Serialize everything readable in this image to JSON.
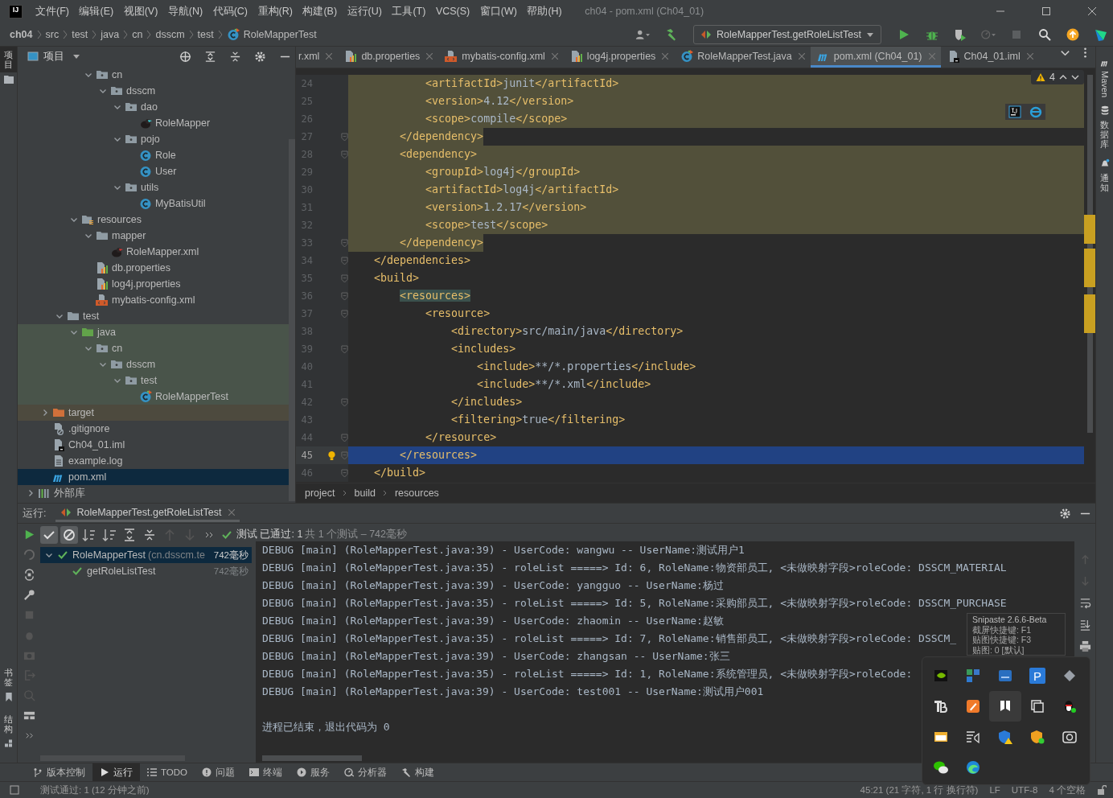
{
  "title_bar": {
    "logo": "IJ",
    "menu": [
      "文件(F)",
      "编辑(E)",
      "视图(V)",
      "导航(N)",
      "代码(C)",
      "重构(R)",
      "构建(B)",
      "运行(U)",
      "工具(T)",
      "VCS(S)",
      "窗口(W)",
      "帮助(H)"
    ],
    "title": "ch04 - pom.xml (Ch04_01)"
  },
  "nav_bar": {
    "breadcrumbs": [
      {
        "label": "ch04",
        "kind": "root"
      },
      {
        "label": "src",
        "kind": "dir"
      },
      {
        "label": "test",
        "kind": "dir"
      },
      {
        "label": "java",
        "kind": "dir"
      },
      {
        "label": "cn",
        "kind": "dir"
      },
      {
        "label": "dsscm",
        "kind": "dir"
      },
      {
        "label": "test",
        "kind": "dir"
      },
      {
        "label": "RoleMapperTest",
        "kind": "test-class"
      }
    ],
    "run_config": "RoleMapperTest.getRoleListTest"
  },
  "left_strip": {
    "top": [
      {
        "label": "项目",
        "selected": true
      }
    ],
    "bottom": [
      {
        "label": "书签",
        "kind": "bookmark"
      },
      {
        "label": "结构",
        "kind": "structure"
      }
    ]
  },
  "project_panel": {
    "title": "项目",
    "tree": [
      {
        "children": [
          {
            "children": [
              {
                "children": [
                  {
                    "children": [
                      {
                        "name": "cn",
                        "kind": "package",
                        "expanded": true,
                        "selected": false,
                        "children": [
                          {
                            "name": "dsscm",
                            "kind": "package",
                            "expanded": true,
                            "selected": false,
                            "children": [
                              {
                                "name": "dao",
                                "kind": "package",
                                "expanded": true,
                                "selected": false,
                                "children": [
                                  {
                                    "name": "RoleMapper",
                                    "kind": "mapper",
                                    "selected": false
                                  }
                                ]
                              },
                              {
                                "name": "pojo",
                                "kind": "package",
                                "expanded": true,
                                "selected": false,
                                "children": [
                                  {
                                    "name": "Role",
                                    "kind": "class",
                                    "selected": false
                                  },
                                  {
                                    "name": "User",
                                    "kind": "class",
                                    "selected": false
                                  }
                                ]
                              },
                              {
                                "name": "utils",
                                "kind": "package",
                                "expanded": true,
                                "selected": false,
                                "children": [
                                  {
                                    "name": "MyBatisUtil",
                                    "kind": "class",
                                    "selected": false
                                  }
                                ]
                              }
                            ]
                          }
                        ]
                      }
                    ]
                  },
                  {
                    "name": "resources",
                    "kind": "resources",
                    "expanded": true,
                    "selected": false,
                    "children": [
                      {
                        "name": "mapper",
                        "kind": "folder",
                        "expanded": true,
                        "selected": false,
                        "children": [
                          {
                            "name": "RoleMapper.xml",
                            "kind": "mapper-xml",
                            "selected": false
                          }
                        ]
                      },
                      {
                        "name": "db.properties",
                        "kind": "properties",
                        "selected": false
                      },
                      {
                        "name": "log4j.properties",
                        "kind": "properties",
                        "selected": false
                      },
                      {
                        "name": "mybatis-config.xml",
                        "kind": "xml-config",
                        "selected": false
                      }
                    ]
                  }
                ]
              },
              {
                "name": "test",
                "kind": "folder",
                "expanded": true,
                "selected": false,
                "children": [
                  {
                    "name": "java",
                    "kind": "test-root",
                    "expanded": true,
                    "selected": false,
                    "children": [
                      {
                        "name": "cn",
                        "kind": "package",
                        "expanded": true,
                        "selected": false,
                        "children": [
                          {
                            "name": "dsscm",
                            "kind": "package",
                            "expanded": true,
                            "selected": false,
                            "children": [
                              {
                                "name": "test",
                                "kind": "package",
                                "expanded": true,
                                "selected": false,
                                "children": [
                                  {
                                    "name": "RoleMapperTest",
                                    "kind": "test-class",
                                    "selected": false
                                  }
                                ]
                              }
                            ]
                          }
                        ]
                      }
                    ]
                  }
                ]
              }
            ]
          },
          {
            "name": "target",
            "kind": "excluded",
            "expanded": false,
            "selected": false
          },
          {
            "name": ".gitignore",
            "kind": "gitignore",
            "selected": false
          },
          {
            "name": "Ch04_01.iml",
            "kind": "iml",
            "selected": false
          },
          {
            "name": "example.log",
            "kind": "log",
            "selected": false
          },
          {
            "name": "pom.xml",
            "kind": "maven",
            "selected": true
          }
        ]
      },
      {
        "name": "外部库",
        "kind": "library",
        "expanded": false,
        "selected": false
      }
    ]
  },
  "editor": {
    "tabs": [
      {
        "label": "r.xml",
        "selected": false
      },
      {
        "label": "db.properties",
        "kind": "properties",
        "selected": false
      },
      {
        "label": "mybatis-config.xml",
        "kind": "xml-config",
        "selected": false
      },
      {
        "label": "log4j.properties",
        "kind": "properties",
        "selected": false
      },
      {
        "label": "RoleMapperTest.java",
        "kind": "test-class",
        "selected": false
      },
      {
        "label": "pom.xml (Ch04_01)",
        "kind": "maven",
        "selected": true
      },
      {
        "label": "Ch04_01.iml",
        "kind": "iml",
        "selected": false
      }
    ],
    "warnings": "4",
    "lines": [
      {
        "number": "24",
        "text": "            <artifactId>junit</artifactId>",
        "kind": "block",
        "fold": false,
        "current": false
      },
      {
        "number": "25",
        "text": "            <version>4.12</version>",
        "kind": "block",
        "fold": false,
        "current": false
      },
      {
        "number": "26",
        "text": "            <scope>compile</scope>",
        "kind": "block",
        "fold": false,
        "current": false
      },
      {
        "number": "27",
        "text": "        </dependency>",
        "kind": "partial",
        "fold": true,
        "current": false
      },
      {
        "number": "28",
        "text": "        <dependency>",
        "kind": "block",
        "fold": true,
        "current": false
      },
      {
        "number": "29",
        "text": "            <groupId>log4j</groupId>",
        "kind": "block",
        "fold": false,
        "current": false
      },
      {
        "number": "30",
        "text": "            <artifactId>log4j</artifactId>",
        "kind": "block",
        "fold": false,
        "current": false
      },
      {
        "number": "31",
        "text": "            <version>1.2.17</version>",
        "kind": "block",
        "fold": false,
        "current": false
      },
      {
        "number": "32",
        "text": "            <scope>test</scope>",
        "kind": "block",
        "fold": false,
        "current": false
      },
      {
        "number": "33",
        "text": "        </dependency>",
        "kind": "partial",
        "fold": true,
        "current": false
      },
      {
        "number": "34",
        "text": "    </dependencies>",
        "kind": "plain",
        "fold": true,
        "current": false
      },
      {
        "number": "35",
        "text": "    <build>",
        "kind": "plain",
        "fold": true,
        "current": false
      },
      {
        "number": "36",
        "text": "        <resources>",
        "kind": "match",
        "fold": true,
        "current": false
      },
      {
        "number": "37",
        "text": "            <resource>",
        "kind": "plain",
        "fold": true,
        "current": false
      },
      {
        "number": "38",
        "text": "                <directory>src/main/java</directory>",
        "kind": "plain",
        "fold": false,
        "current": false
      },
      {
        "number": "39",
        "text": "                <includes>",
        "kind": "plain",
        "fold": true,
        "current": false
      },
      {
        "number": "40",
        "text": "                    <include>**/*.properties</include>",
        "kind": "plain",
        "fold": false,
        "current": false
      },
      {
        "number": "41",
        "text": "                    <include>**/*.xml</include>",
        "kind": "plain",
        "fold": false,
        "current": false
      },
      {
        "number": "42",
        "text": "                </includes>",
        "kind": "plain",
        "fold": true,
        "current": false
      },
      {
        "number": "43",
        "text": "                <filtering>true</filtering>",
        "kind": "plain",
        "fold": false,
        "current": false
      },
      {
        "number": "44",
        "text": "            </resource>",
        "kind": "plain",
        "fold": true,
        "current": false
      },
      {
        "number": "45",
        "text": "        </resources>",
        "kind": "plain",
        "fold": true,
        "current": true
      },
      {
        "number": "46",
        "text": "    </build>",
        "kind": "plain",
        "fold": true,
        "current": false
      }
    ],
    "breadcrumbs": [
      "project",
      "build",
      "resources"
    ]
  },
  "right_strip": [
    {
      "label": "Maven",
      "kind": "maven"
    },
    {
      "label": "数据库",
      "kind": "database"
    },
    {
      "label": "通知",
      "kind": "bell"
    }
  ],
  "run_panel": {
    "label": "运行:",
    "tab": "RoleMapperTest.getRoleListTest",
    "status": "测试 已通过: 1",
    "status_detail": "共 1 个测试 – 742毫秒",
    "tests": [
      {
        "name": "RoleMapperTest",
        "detail": "(cn.dsscm.te",
        "time": "742毫秒",
        "expanded": true,
        "selected": true,
        "children": [
          {
            "name": "getRoleListTest",
            "time": "742毫秒",
            "selected": false
          }
        ]
      }
    ],
    "console": [
      "DEBUG [main] (RoleMapperTest.java:39) - UserCode: wangwu -- UserName:测试用户1",
      "DEBUG [main] (RoleMapperTest.java:35) - roleList =====> Id: 6, RoleName:物资部员工, <未做映射字段>roleCode: DSSCM_MATERIAL",
      "DEBUG [main] (RoleMapperTest.java:39) - UserCode: yangguo -- UserName:杨过",
      "DEBUG [main] (RoleMapperTest.java:35) - roleList =====> Id: 5, RoleName:采购部员工, <未做映射字段>roleCode: DSSCM_PURCHASE",
      "DEBUG [main] (RoleMapperTest.java:39) - UserCode: zhaomin -- UserName:赵敏",
      "DEBUG [main] (RoleMapperTest.java:35) - roleList =====> Id: 7, RoleName:销售部员工, <未做映射字段>roleCode: DSSCM_",
      "DEBUG [main] (RoleMapperTest.java:39) - UserCode: zhangsan -- UserName:张三",
      "DEBUG [main] (RoleMapperTest.java:35) - roleList =====> Id: 1, RoleName:系统管理员, <未做映射字段>roleCode:",
      "DEBUG [main] (RoleMapperTest.java:39) - UserCode: test001 -- UserName:测试用户001"
    ],
    "exit": "进程已结束，退出代码为 0"
  },
  "tool_tabs": [
    {
      "label": "版本控制",
      "kind": "vcs",
      "selected": false
    },
    {
      "label": "运行",
      "kind": "run",
      "selected": true
    },
    {
      "label": "TODO",
      "kind": "todo",
      "selected": false
    },
    {
      "label": "问题",
      "kind": "problems",
      "selected": false
    },
    {
      "label": "终端",
      "kind": "terminal",
      "selected": false
    },
    {
      "label": "服务",
      "kind": "services",
      "selected": false
    },
    {
      "label": "分析器",
      "kind": "profiler",
      "selected": false
    },
    {
      "label": "构建",
      "kind": "build",
      "selected": false
    }
  ],
  "status_bar": {
    "message": "测试通过: 1 (12 分钟之前)",
    "items": [
      "45:21 (21 字符, 1 行 换行符)",
      "LF",
      "UTF-8",
      "4 个空格"
    ]
  },
  "tray": {
    "tooltip": [
      "Snipaste 2.6.6-Beta",
      "截屏快捷键: F1",
      "贴图快捷键: F3",
      "贴图: 0 [默认]"
    ],
    "icons": [
      {
        "kind": "chip",
        "selected": false
      },
      {
        "kind": "tiles",
        "selected": false
      },
      {
        "kind": "blue-app",
        "selected": false
      },
      {
        "kind": "letter-app",
        "label": "P",
        "selected": false
      },
      {
        "kind": "diamond",
        "selected": false
      },
      {
        "kind": "tb",
        "selected": false
      },
      {
        "kind": "pen",
        "selected": false
      },
      {
        "kind": "squares",
        "selected": true
      },
      {
        "kind": "copy",
        "selected": false
      },
      {
        "kind": "penguin",
        "selected": false
      },
      {
        "kind": "window",
        "selected": false
      },
      {
        "kind": "cast",
        "selected": false
      },
      {
        "kind": "shield-warning",
        "selected": false
      },
      {
        "kind": "shield-orange",
        "selected": false
      },
      {
        "kind": "camera",
        "selected": false
      },
      {
        "kind": "chat",
        "selected": false
      },
      {
        "kind": "browser",
        "selected": false
      }
    ]
  }
}
